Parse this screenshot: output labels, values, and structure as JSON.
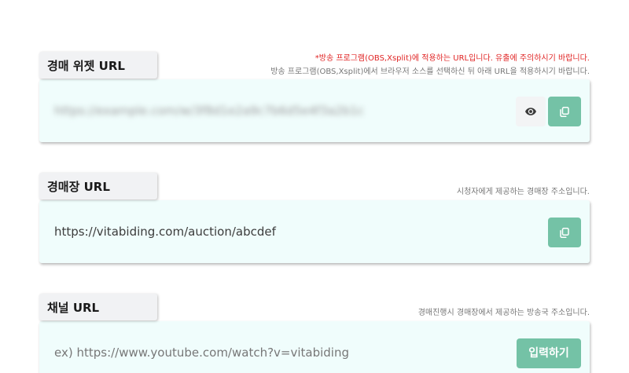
{
  "widget": {
    "title": "경매 위젯 URL",
    "warning_note": "*방송 프로그램(OBS,Xsplit)에 적용하는 URL입니다. 유출에 주의하시기 바랍니다.",
    "info_note": "방송 프로그램(OBS,Xsplit)에서 브라우저 소스를 선택하신 뒤 아래 URL을 적용하시기 바랍니다.",
    "url_value": "https://example.com/w/3f8d1e2a9c7b6d5e4f3a2b1c",
    "eye_icon": "eye-icon",
    "copy_icon": "copy-icon"
  },
  "auction": {
    "title": "경매장 URL",
    "info_note": "시청자에게 제공하는 경매장 주소입니다.",
    "url_value": "https://vitabiding.com/auction/abcdef",
    "copy_icon": "copy-icon"
  },
  "channel": {
    "title": "채널 URL",
    "info_note": "경매진행시 경매장에서 제공하는 방송국 주소입니다.",
    "placeholder": "ex) https://www.youtube.com/watch?v=vitabiding",
    "input_button": "입력하기"
  },
  "colors": {
    "accent": "#74c2a6",
    "card_bg": "#f0fdfc",
    "warning": "#e02424"
  }
}
